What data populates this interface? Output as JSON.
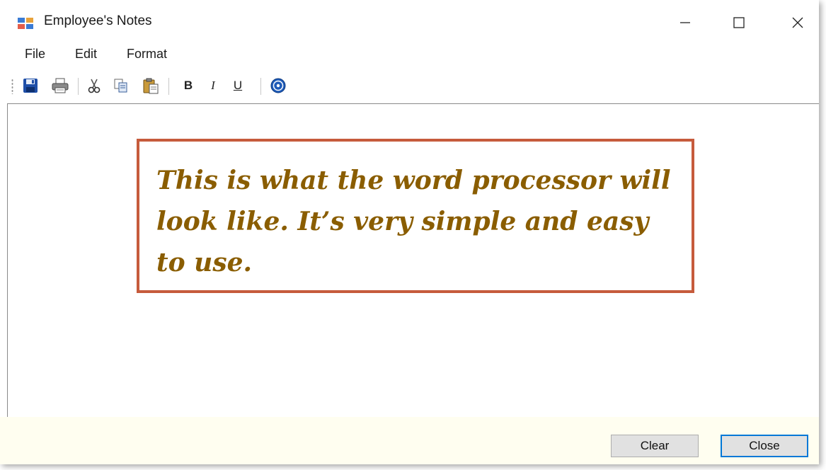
{
  "window": {
    "title": "Employee's Notes"
  },
  "menubar": {
    "items": [
      "File",
      "Edit",
      "Format"
    ]
  },
  "toolbar": {
    "buttons": [
      "save-icon",
      "print-icon",
      "cut-icon",
      "copy-icon",
      "paste-icon",
      "bold",
      "italic",
      "underline",
      "help-icon"
    ],
    "bold_label": "B",
    "italic_label": "I",
    "underline_label": "U"
  },
  "editor": {
    "callout_text": "This is what the word processor will look like. It’s very simple and easy to use."
  },
  "footer": {
    "clear_label": "Clear",
    "close_label": "Close"
  },
  "colors": {
    "callout_border": "#c65b3c",
    "callout_text": "#8a5d00",
    "footer_background": "#fffef0",
    "focus_border": "#0078d7"
  }
}
